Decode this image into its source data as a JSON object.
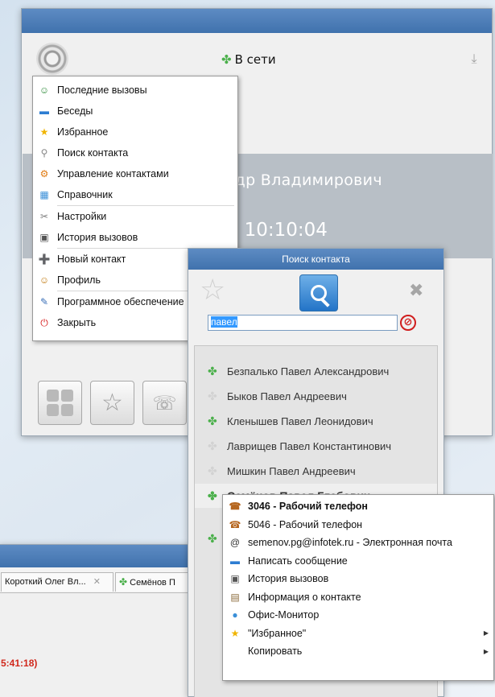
{
  "main": {
    "status": "В сети",
    "name": "андр Владимирович",
    "time": "18 10:10:04"
  },
  "main_menu": {
    "items": [
      {
        "label": "Последние вызовы",
        "icon": "people-icon",
        "color": "#2e8b3a",
        "glyph": "☺"
      },
      {
        "label": "Беседы",
        "icon": "chat-icon",
        "color": "#2d7dd2",
        "glyph": "▬"
      },
      {
        "label": "Избранное",
        "icon": "star-icon",
        "color": "#f0b400",
        "glyph": "★"
      },
      {
        "label": "Поиск контакта",
        "icon": "search-icon",
        "color": "#888888",
        "glyph": "⚲"
      },
      {
        "label": "Управление контактами",
        "icon": "contacts-gear-icon",
        "color": "#e07a10",
        "glyph": "⚙"
      },
      {
        "label": "Справочник",
        "icon": "directory-icon",
        "color": "#3a8fd8",
        "glyph": "▦"
      },
      {
        "label": "Настройки",
        "icon": "tools-icon",
        "color": "#7a7a7a",
        "glyph": "✂"
      },
      {
        "label": "История вызовов",
        "icon": "history-icon",
        "color": "#555555",
        "glyph": "▣"
      },
      {
        "label": "Новый контакт",
        "icon": "add-contact-icon",
        "color": "#2aa24a",
        "glyph": "➕"
      },
      {
        "label": "Профиль",
        "icon": "profile-icon",
        "color": "#c07a10",
        "glyph": "☺"
      },
      {
        "label": "Программное обеспечение",
        "icon": "software-icon",
        "color": "#3a6fb8",
        "glyph": "✎"
      },
      {
        "label": "Закрыть",
        "icon": "close-app-icon",
        "color": "#d82020",
        "glyph": "⏻"
      }
    ]
  },
  "search_window": {
    "title": "Поиск контакта",
    "query": "павел",
    "results": [
      {
        "name": "Безпалько Павел Александрович",
        "online": true
      },
      {
        "name": "Быков Павел Андреевич",
        "online": false
      },
      {
        "name": "Кленышев Павел Леонидович",
        "online": true
      },
      {
        "name": "Лаврищев Павел Константинович",
        "online": false
      },
      {
        "name": "Мишкин Павел Андреевич",
        "online": false
      },
      {
        "name": "Семёнов Павел Глебович",
        "online": true,
        "selected": true
      }
    ]
  },
  "context_menu": {
    "items": [
      {
        "label": "3046 - Рабочий телефон",
        "bold": true,
        "icon": "phone-icon",
        "color": "#b5651d",
        "glyph": "☎"
      },
      {
        "label": "5046 - Рабочий телефон",
        "icon": "phone-icon",
        "color": "#b5651d",
        "glyph": "☎"
      },
      {
        "label": "semenov.pg@infotek.ru - Электронная почта",
        "icon": "email-icon",
        "color": "#333333",
        "glyph": "@"
      },
      {
        "label": "Написать сообщение",
        "icon": "message-icon",
        "color": "#2d7dd2",
        "glyph": "▬"
      },
      {
        "label": "История вызовов",
        "icon": "history-icon",
        "color": "#555555",
        "glyph": "▣"
      },
      {
        "label": "Информация о контакте",
        "icon": "contact-card-icon",
        "color": "#8a6a3a",
        "glyph": "▤"
      },
      {
        "label": "Офис-Монитор",
        "icon": "monitor-icon",
        "color": "#3a8fd8",
        "glyph": "●"
      },
      {
        "label": "\"Избранное\"",
        "icon": "star-icon",
        "color": "#f0b400",
        "glyph": "★",
        "submenu": true
      },
      {
        "label": "Копировать",
        "icon": "",
        "color": "#ffffff",
        "glyph": "",
        "submenu": true
      }
    ]
  },
  "chat_window": {
    "tabs": [
      "Короткий Олег Вл...",
      "Семёнов П"
    ],
    "time": "5:41:18)"
  }
}
